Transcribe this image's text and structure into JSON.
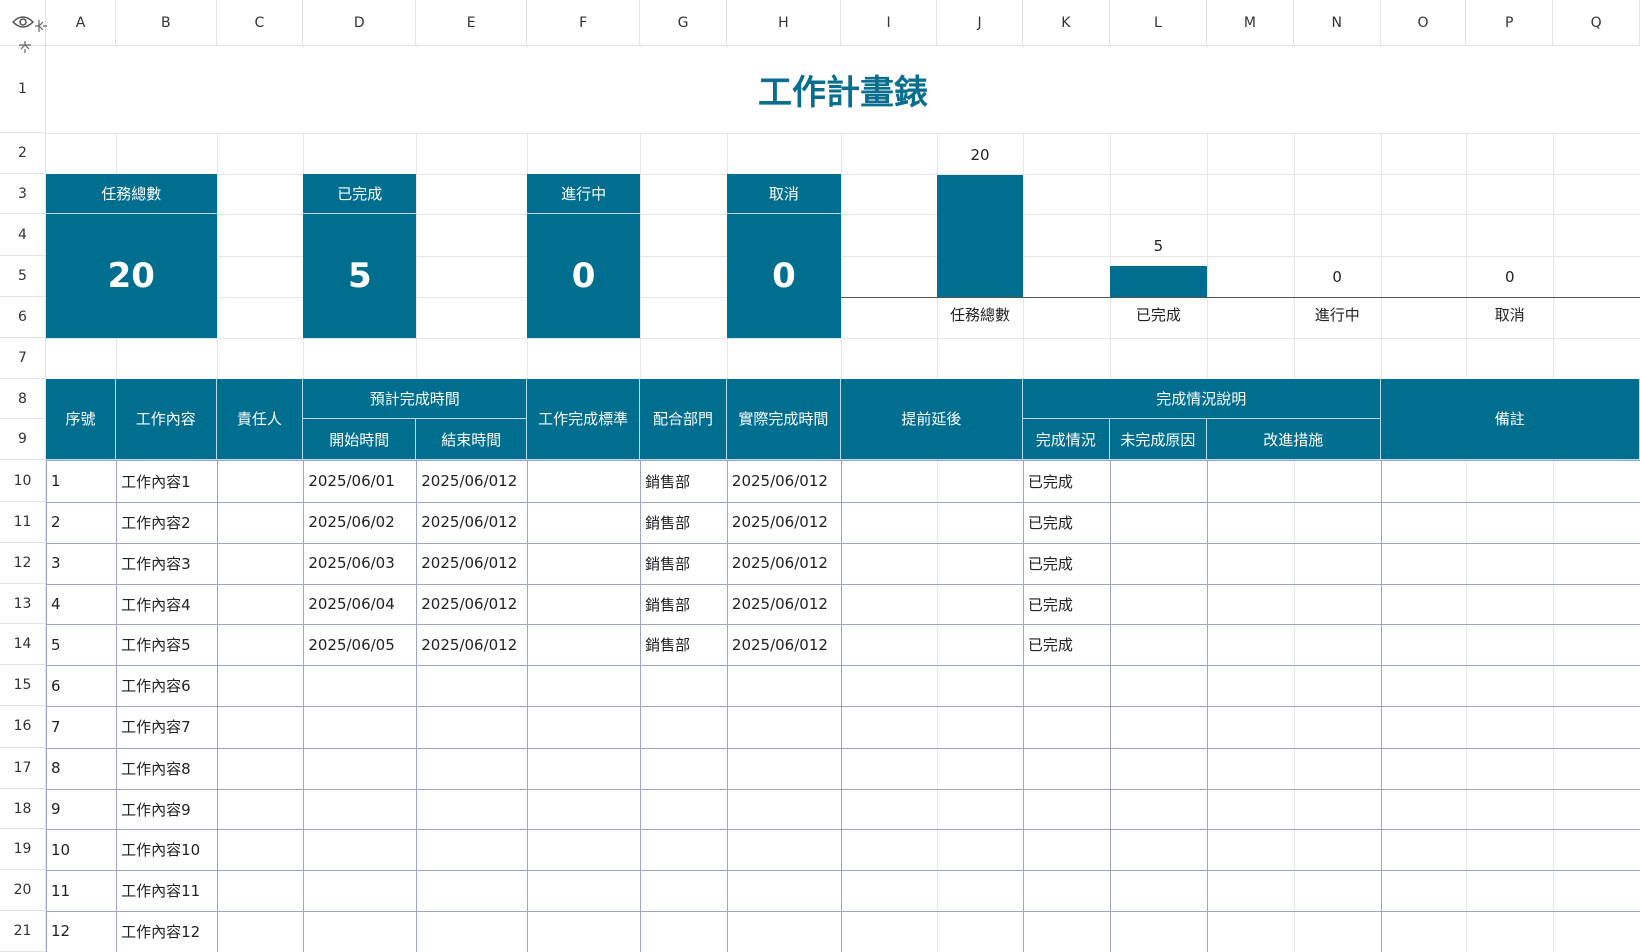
{
  "title": "工作計畫錶",
  "columns": [
    "A",
    "B",
    "C",
    "D",
    "E",
    "F",
    "G",
    "H",
    "I",
    "J",
    "K",
    "L",
    "M",
    "N",
    "O",
    "P",
    "Q"
  ],
  "rows": [
    "1",
    "2",
    "3",
    "4",
    "5",
    "6",
    "7",
    "8",
    "9",
    "10",
    "11",
    "12",
    "13",
    "14",
    "15",
    "16",
    "17",
    "18",
    "19",
    "20",
    "21"
  ],
  "icons": {
    "eye": "eye-icon",
    "freeze": "freeze-panes-icon"
  },
  "cards": [
    {
      "label": "任務總數",
      "value": "20"
    },
    {
      "label": "已完成",
      "value": "5"
    },
    {
      "label": "進行中",
      "value": "0"
    },
    {
      "label": "取消",
      "value": "0"
    }
  ],
  "chart_data": {
    "type": "bar",
    "categories": [
      "任務總數",
      "已完成",
      "進行中",
      "取消"
    ],
    "values": [
      20,
      5,
      0,
      0
    ],
    "data_labels": [
      "20",
      "5",
      "0",
      "0"
    ],
    "color": "#006e8f",
    "grid": false
  },
  "table": {
    "headers": {
      "seq": "序號",
      "content": "工作內容",
      "owner": "責任人",
      "planned": "預計完成時間",
      "start": "開始時間",
      "end": "結束時間",
      "standard": "工作完成標準",
      "dept": "配合部門",
      "actual": "實際完成時間",
      "ahead": "提前延後",
      "completion": "完成情況說明",
      "status": "完成情況",
      "reason": "未完成原因",
      "improve": "改進措施",
      "note": "備註"
    },
    "rows": [
      {
        "seq": "1",
        "content": "工作內容1",
        "start": "2025/06/01",
        "end": "2025/06/012",
        "dept": "銷售部",
        "actual": "2025/06/012",
        "status": "已完成"
      },
      {
        "seq": "2",
        "content": "工作內容2",
        "start": "2025/06/02",
        "end": "2025/06/012",
        "dept": "銷售部",
        "actual": "2025/06/012",
        "status": "已完成"
      },
      {
        "seq": "3",
        "content": "工作內容3",
        "start": "2025/06/03",
        "end": "2025/06/012",
        "dept": "銷售部",
        "actual": "2025/06/012",
        "status": "已完成"
      },
      {
        "seq": "4",
        "content": "工作內容4",
        "start": "2025/06/04",
        "end": "2025/06/012",
        "dept": "銷售部",
        "actual": "2025/06/012",
        "status": "已完成"
      },
      {
        "seq": "5",
        "content": "工作內容5",
        "start": "2025/06/05",
        "end": "2025/06/012",
        "dept": "銷售部",
        "actual": "2025/06/012",
        "status": "已完成"
      },
      {
        "seq": "6",
        "content": "工作內容6",
        "start": "",
        "end": "",
        "dept": "",
        "actual": "",
        "status": ""
      },
      {
        "seq": "7",
        "content": "工作內容7",
        "start": "",
        "end": "",
        "dept": "",
        "actual": "",
        "status": ""
      },
      {
        "seq": "8",
        "content": "工作內容8",
        "start": "",
        "end": "",
        "dept": "",
        "actual": "",
        "status": ""
      },
      {
        "seq": "9",
        "content": "工作內容9",
        "start": "",
        "end": "",
        "dept": "",
        "actual": "",
        "status": ""
      },
      {
        "seq": "10",
        "content": "工作內容10",
        "start": "",
        "end": "",
        "dept": "",
        "actual": "",
        "status": ""
      },
      {
        "seq": "11",
        "content": "工作內容11",
        "start": "",
        "end": "",
        "dept": "",
        "actual": "",
        "status": ""
      },
      {
        "seq": "12",
        "content": "工作內容12",
        "start": "",
        "end": "",
        "dept": "",
        "actual": "",
        "status": ""
      }
    ]
  }
}
